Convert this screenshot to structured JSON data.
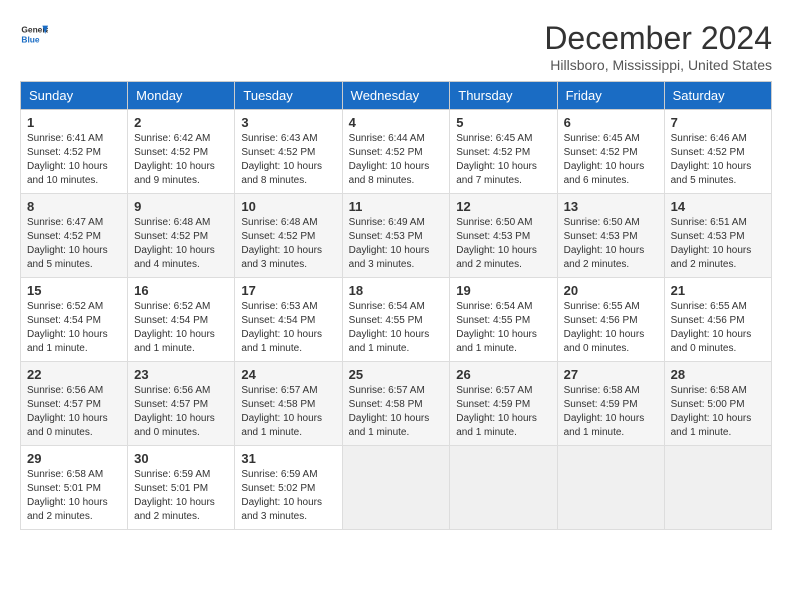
{
  "logo": {
    "general": "General",
    "blue": "Blue"
  },
  "title": "December 2024",
  "location": "Hillsboro, Mississippi, United States",
  "headers": [
    "Sunday",
    "Monday",
    "Tuesday",
    "Wednesday",
    "Thursday",
    "Friday",
    "Saturday"
  ],
  "weeks": [
    [
      {
        "day": "1",
        "sunrise": "6:41 AM",
        "sunset": "4:52 PM",
        "daylight": "10 hours and 10 minutes."
      },
      {
        "day": "2",
        "sunrise": "6:42 AM",
        "sunset": "4:52 PM",
        "daylight": "10 hours and 9 minutes."
      },
      {
        "day": "3",
        "sunrise": "6:43 AM",
        "sunset": "4:52 PM",
        "daylight": "10 hours and 8 minutes."
      },
      {
        "day": "4",
        "sunrise": "6:44 AM",
        "sunset": "4:52 PM",
        "daylight": "10 hours and 8 minutes."
      },
      {
        "day": "5",
        "sunrise": "6:45 AM",
        "sunset": "4:52 PM",
        "daylight": "10 hours and 7 minutes."
      },
      {
        "day": "6",
        "sunrise": "6:45 AM",
        "sunset": "4:52 PM",
        "daylight": "10 hours and 6 minutes."
      },
      {
        "day": "7",
        "sunrise": "6:46 AM",
        "sunset": "4:52 PM",
        "daylight": "10 hours and 5 minutes."
      }
    ],
    [
      {
        "day": "8",
        "sunrise": "6:47 AM",
        "sunset": "4:52 PM",
        "daylight": "10 hours and 5 minutes."
      },
      {
        "day": "9",
        "sunrise": "6:48 AM",
        "sunset": "4:52 PM",
        "daylight": "10 hours and 4 minutes."
      },
      {
        "day": "10",
        "sunrise": "6:48 AM",
        "sunset": "4:52 PM",
        "daylight": "10 hours and 3 minutes."
      },
      {
        "day": "11",
        "sunrise": "6:49 AM",
        "sunset": "4:53 PM",
        "daylight": "10 hours and 3 minutes."
      },
      {
        "day": "12",
        "sunrise": "6:50 AM",
        "sunset": "4:53 PM",
        "daylight": "10 hours and 2 minutes."
      },
      {
        "day": "13",
        "sunrise": "6:50 AM",
        "sunset": "4:53 PM",
        "daylight": "10 hours and 2 minutes."
      },
      {
        "day": "14",
        "sunrise": "6:51 AM",
        "sunset": "4:53 PM",
        "daylight": "10 hours and 2 minutes."
      }
    ],
    [
      {
        "day": "15",
        "sunrise": "6:52 AM",
        "sunset": "4:54 PM",
        "daylight": "10 hours and 1 minute."
      },
      {
        "day": "16",
        "sunrise": "6:52 AM",
        "sunset": "4:54 PM",
        "daylight": "10 hours and 1 minute."
      },
      {
        "day": "17",
        "sunrise": "6:53 AM",
        "sunset": "4:54 PM",
        "daylight": "10 hours and 1 minute."
      },
      {
        "day": "18",
        "sunrise": "6:54 AM",
        "sunset": "4:55 PM",
        "daylight": "10 hours and 1 minute."
      },
      {
        "day": "19",
        "sunrise": "6:54 AM",
        "sunset": "4:55 PM",
        "daylight": "10 hours and 1 minute."
      },
      {
        "day": "20",
        "sunrise": "6:55 AM",
        "sunset": "4:56 PM",
        "daylight": "10 hours and 0 minutes."
      },
      {
        "day": "21",
        "sunrise": "6:55 AM",
        "sunset": "4:56 PM",
        "daylight": "10 hours and 0 minutes."
      }
    ],
    [
      {
        "day": "22",
        "sunrise": "6:56 AM",
        "sunset": "4:57 PM",
        "daylight": "10 hours and 0 minutes."
      },
      {
        "day": "23",
        "sunrise": "6:56 AM",
        "sunset": "4:57 PM",
        "daylight": "10 hours and 0 minutes."
      },
      {
        "day": "24",
        "sunrise": "6:57 AM",
        "sunset": "4:58 PM",
        "daylight": "10 hours and 1 minute."
      },
      {
        "day": "25",
        "sunrise": "6:57 AM",
        "sunset": "4:58 PM",
        "daylight": "10 hours and 1 minute."
      },
      {
        "day": "26",
        "sunrise": "6:57 AM",
        "sunset": "4:59 PM",
        "daylight": "10 hours and 1 minute."
      },
      {
        "day": "27",
        "sunrise": "6:58 AM",
        "sunset": "4:59 PM",
        "daylight": "10 hours and 1 minute."
      },
      {
        "day": "28",
        "sunrise": "6:58 AM",
        "sunset": "5:00 PM",
        "daylight": "10 hours and 1 minute."
      }
    ],
    [
      {
        "day": "29",
        "sunrise": "6:58 AM",
        "sunset": "5:01 PM",
        "daylight": "10 hours and 2 minutes."
      },
      {
        "day": "30",
        "sunrise": "6:59 AM",
        "sunset": "5:01 PM",
        "daylight": "10 hours and 2 minutes."
      },
      {
        "day": "31",
        "sunrise": "6:59 AM",
        "sunset": "5:02 PM",
        "daylight": "10 hours and 3 minutes."
      },
      null,
      null,
      null,
      null
    ]
  ]
}
